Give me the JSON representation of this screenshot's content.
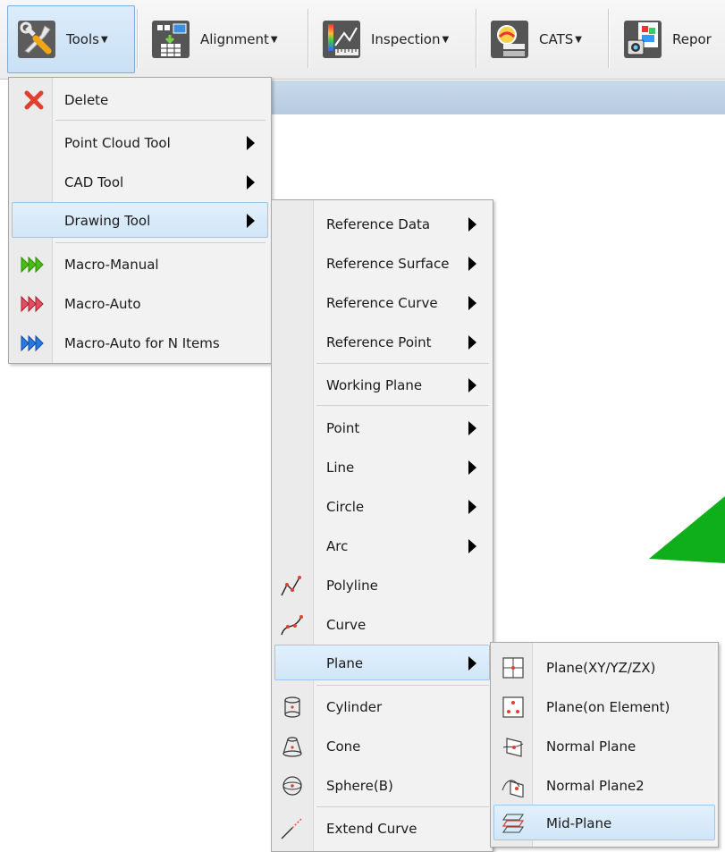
{
  "toolbar": {
    "tools": {
      "label": "Tools",
      "icon": "wrench-screwdriver-icon"
    },
    "alignment": {
      "label": "Alignment",
      "icon": "grid-alignment-icon"
    },
    "inspection": {
      "label": "Inspection",
      "icon": "color-map-inspection-icon"
    },
    "cats": {
      "label": "CATS",
      "icon": "cats-icon"
    },
    "report": {
      "label": "Repor",
      "icon": "report-icon"
    }
  },
  "tools_menu": {
    "items": [
      {
        "label": "Delete",
        "icon": "delete-x-icon"
      },
      {
        "label": "Point Cloud Tool"
      },
      {
        "label": "CAD Tool"
      },
      {
        "label": "Drawing Tool"
      },
      {
        "label": "Macro-Manual",
        "icon": "macro-manual-icon",
        "color": "#4cbb17"
      },
      {
        "label": "Macro-Auto",
        "icon": "macro-auto-icon",
        "color": "#e05060"
      },
      {
        "label": "Macro-Auto for N Items",
        "icon": "macro-auto-n-icon",
        "color": "#2a7ae2"
      }
    ]
  },
  "drawing_menu": {
    "items": [
      {
        "label": "Reference Data"
      },
      {
        "label": "Reference Surface"
      },
      {
        "label": "Reference Curve"
      },
      {
        "label": "Reference Point"
      },
      {
        "label": "Working Plane"
      },
      {
        "label": "Point"
      },
      {
        "label": "Line"
      },
      {
        "label": "Circle"
      },
      {
        "label": "Arc"
      },
      {
        "label": "Polyline",
        "icon": "polyline-icon"
      },
      {
        "label": "Curve",
        "icon": "curve-icon"
      },
      {
        "label": "Plane"
      },
      {
        "label": "Cylinder",
        "icon": "cylinder-icon"
      },
      {
        "label": "Cone",
        "icon": "cone-icon"
      },
      {
        "label": "Sphere(B)",
        "icon": "sphere-icon"
      },
      {
        "label": "Extend Curve",
        "icon": "extend-curve-icon"
      }
    ]
  },
  "plane_menu": {
    "items": [
      {
        "label": "Plane(XY/YZ/ZX)",
        "icon": "plane-xy-icon"
      },
      {
        "label": "Plane(on Element)",
        "icon": "plane-on-element-icon"
      },
      {
        "label": "Normal Plane",
        "icon": "normal-plane-icon"
      },
      {
        "label": "Normal Plane2",
        "icon": "normal-plane2-icon"
      },
      {
        "label": "Mid-Plane",
        "icon": "mid-plane-icon"
      }
    ]
  },
  "colors": {
    "highlight": "#d0e6f8",
    "accent_red": "#e0412f",
    "canvas_green": "#0fae1b"
  }
}
